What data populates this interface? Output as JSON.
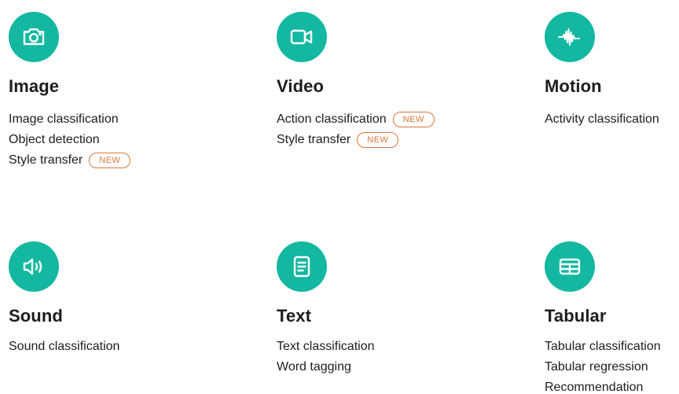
{
  "accent_color": "#14b8a1",
  "badge_color": "#d9773a",
  "categories": [
    {
      "icon": "camera-icon",
      "title": "Image",
      "items": [
        {
          "label": "Image classification",
          "badge": ""
        },
        {
          "label": "Object detection",
          "badge": ""
        },
        {
          "label": "Style transfer",
          "badge": "NEW"
        }
      ]
    },
    {
      "icon": "video-camera-icon",
      "title": "Video",
      "items": [
        {
          "label": "Action classification",
          "badge": "NEW"
        },
        {
          "label": "Style transfer",
          "badge": "NEW"
        }
      ]
    },
    {
      "icon": "waveform-icon",
      "title": "Motion",
      "items": [
        {
          "label": "Activity classification",
          "badge": ""
        }
      ]
    },
    {
      "icon": "speaker-icon",
      "title": "Sound",
      "items": [
        {
          "label": "Sound classification",
          "badge": ""
        }
      ]
    },
    {
      "icon": "document-icon",
      "title": "Text",
      "items": [
        {
          "label": "Text classification",
          "badge": ""
        },
        {
          "label": "Word tagging",
          "badge": ""
        }
      ]
    },
    {
      "icon": "table-icon",
      "title": "Tabular",
      "items": [
        {
          "label": "Tabular classification",
          "badge": ""
        },
        {
          "label": "Tabular regression",
          "badge": ""
        },
        {
          "label": "Recommendation",
          "badge": ""
        }
      ]
    }
  ]
}
